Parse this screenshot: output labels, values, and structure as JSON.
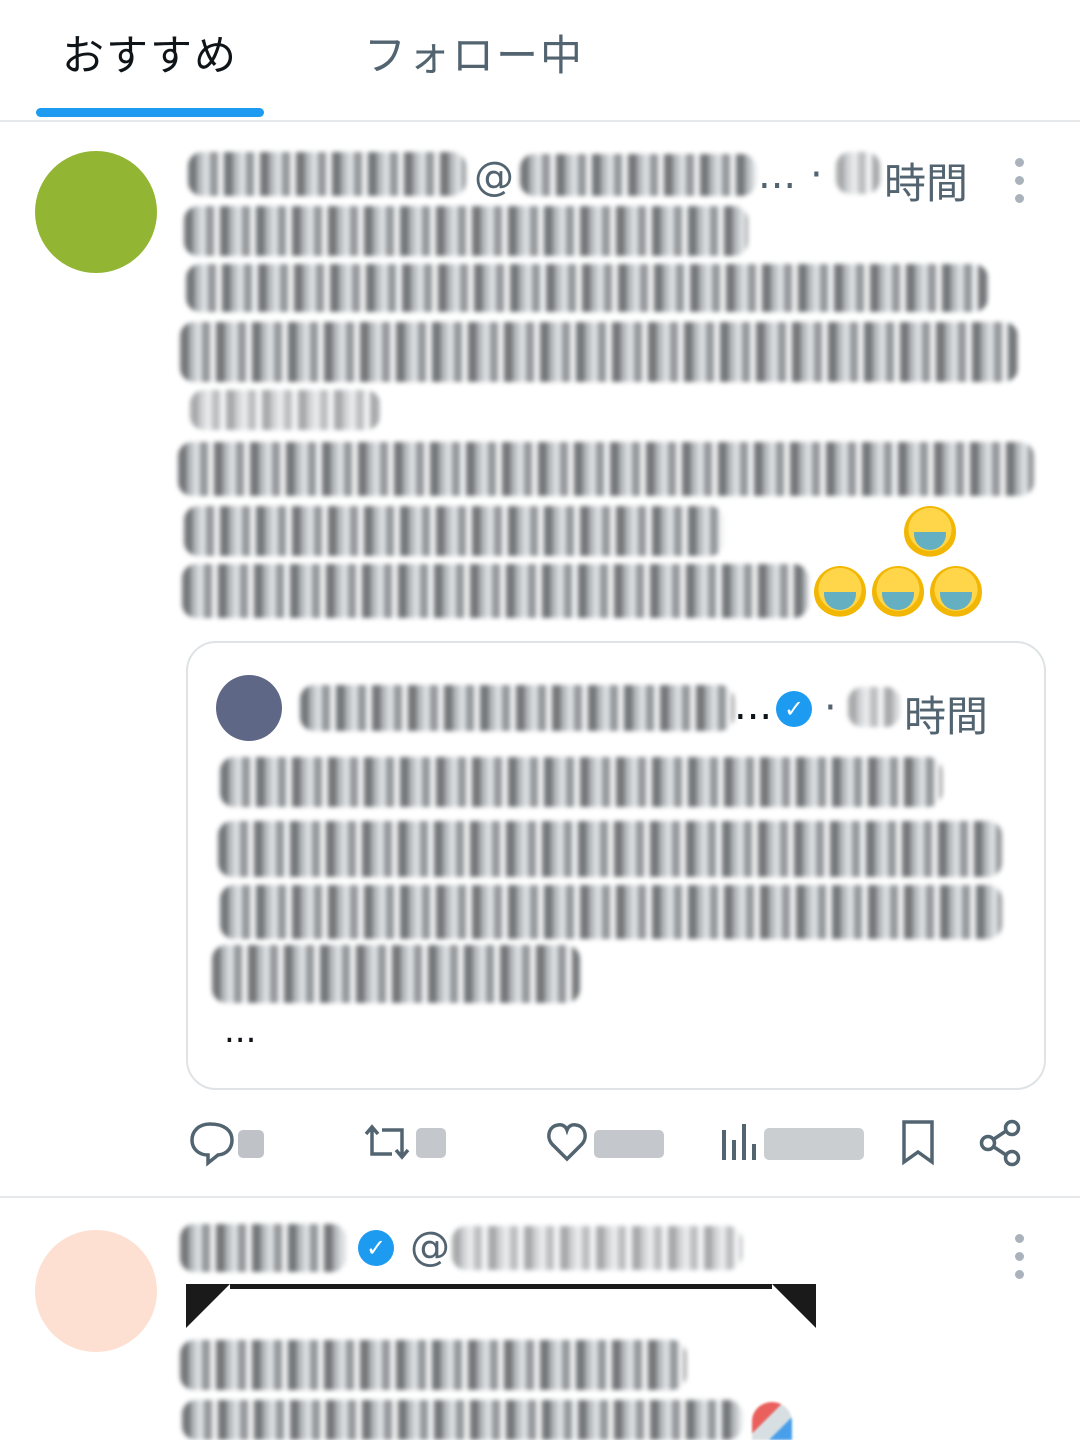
{
  "tabs": [
    {
      "label": "おすすめ",
      "active": true
    },
    {
      "label": "フォロー中",
      "active": false
    }
  ],
  "colors": {
    "accent": "#1d9bf0",
    "text": "#0f1419",
    "secondary_text": "#536471",
    "divider": "#e6e9eb",
    "avatar_1": "#93b534",
    "avatar_quote": "#5f6786",
    "avatar_2": "#fde0d2"
  },
  "post1": {
    "handle_prefix": "@",
    "handle_ellipsis": "...",
    "separator": "·",
    "time_unit": "時間",
    "more_icon": "more-vertical-icon",
    "quote": {
      "verified_icon": "verified-badge-icon",
      "name_ellipsis": "...",
      "separator": "·",
      "time_unit": "時間",
      "truncation": "..."
    },
    "actions": [
      {
        "name": "reply",
        "icon": "reply-icon"
      },
      {
        "name": "repost",
        "icon": "repost-icon"
      },
      {
        "name": "like",
        "icon": "heart-icon"
      },
      {
        "name": "views",
        "icon": "views-chart-icon"
      },
      {
        "name": "bookmark",
        "icon": "bookmark-icon"
      },
      {
        "name": "share",
        "icon": "share-icon"
      }
    ]
  },
  "post2": {
    "handle_prefix": "@",
    "verified_icon": "verified-badge-icon",
    "more_icon": "more-vertical-icon"
  }
}
